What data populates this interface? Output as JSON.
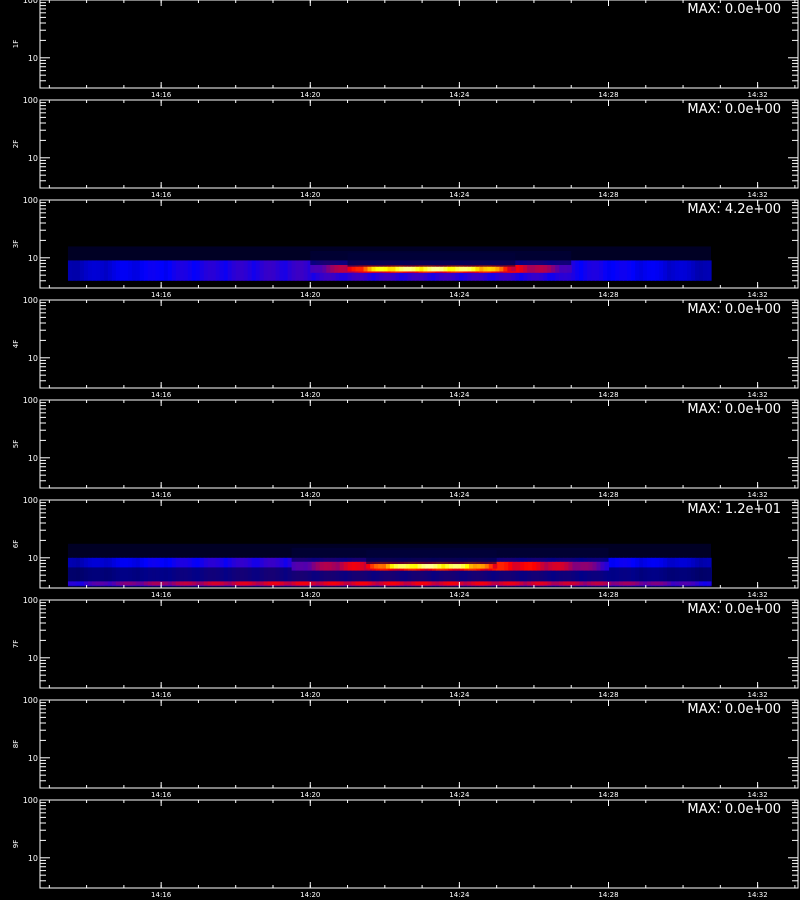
{
  "chart_data": {
    "type": "heatmap",
    "x_ticks": [
      "14:16",
      "14:20",
      "14:24",
      "14:28",
      "14:32"
    ],
    "y_ticks": [
      "100",
      "10"
    ],
    "x_range": [
      "14:12:45",
      "14:33:05"
    ],
    "y_range": [
      3,
      100
    ],
    "y_scale": "log",
    "colormap": [
      "#000000",
      "#0000ff",
      "#ff0000",
      "#ffff00",
      "#ffffff"
    ],
    "panels": [
      {
        "label": "1F",
        "max_text": "MAX: 0.0e+00",
        "max": 0
      },
      {
        "label": "2F",
        "max_text": "MAX: 0.0e+00",
        "max": 0
      },
      {
        "label": "3F",
        "max_text": "MAX: 4.2e+00",
        "max": 4.2,
        "data_end": "14:30:45",
        "bands": [
          {
            "t_start": "14:13:30",
            "t_end": "14:30:45",
            "y_low": 4.0,
            "y_high": 9.0,
            "level": 0.3
          },
          {
            "t_start": "14:20:00",
            "t_end": "14:27:00",
            "y_low": 5.5,
            "y_high": 7.5,
            "level": 0.55
          },
          {
            "t_start": "14:21:00",
            "t_end": "14:25:30",
            "y_low": 5.8,
            "y_high": 7.0,
            "level": 0.85
          }
        ]
      },
      {
        "label": "4F",
        "max_text": "MAX: 0.0e+00",
        "max": 0
      },
      {
        "label": "5F",
        "max_text": "MAX: 0.0e+00",
        "max": 0
      },
      {
        "label": "6F",
        "max_text": "MAX: 1.2e+01",
        "max": 12,
        "data_end": "14:30:45",
        "bands": [
          {
            "t_start": "14:13:30",
            "t_end": "14:30:45",
            "y_low": 3.2,
            "y_high": 10.0,
            "level": 0.3
          },
          {
            "t_start": "14:13:30",
            "t_end": "14:30:45",
            "y_low": 3.3,
            "y_high": 3.9,
            "level": 0.5
          },
          {
            "t_start": "14:19:30",
            "t_end": "14:28:00",
            "y_low": 6.0,
            "y_high": 8.5,
            "level": 0.55
          },
          {
            "t_start": "14:21:30",
            "t_end": "14:25:00",
            "y_low": 6.5,
            "y_high": 7.8,
            "level": 0.85
          }
        ]
      },
      {
        "label": "7F",
        "max_text": "MAX: 0.0e+00",
        "max": 0
      },
      {
        "label": "8F",
        "max_text": "MAX: 0.0e+00",
        "max": 0
      },
      {
        "label": "9F",
        "max_text": "MAX: 0.0e+00",
        "max": 0
      }
    ]
  }
}
